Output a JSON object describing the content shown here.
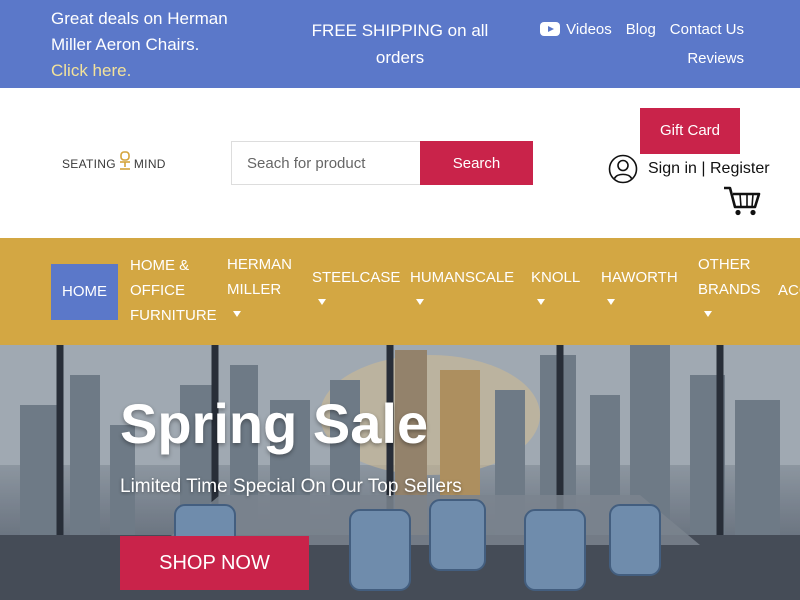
{
  "topbar": {
    "promo_text": "Great deals on Herman Miller Aeron Chairs.",
    "promo_link": "Click here.",
    "shipping": "FREE SHIPPING on all orders",
    "links": {
      "videos": "Videos",
      "blog": "Blog",
      "contact": "Contact Us",
      "reviews": "Reviews"
    }
  },
  "header": {
    "logo_left": "SEATING",
    "logo_right": "MIND",
    "search_placeholder": "Seach for product",
    "search_button": "Search",
    "gift_card": "Gift Card",
    "sign_in": "Sign in",
    "separator": "|",
    "register": "Register"
  },
  "nav": {
    "home": "HOME",
    "home_office_1": "HOME &",
    "home_office_2": "OFFICE",
    "home_office_3": "FURNITURE",
    "herman_1": "HERMAN",
    "herman_2": "MILLER",
    "steelcase": "STEELCASE",
    "humanscale": "HUMANSCALE",
    "knoll": "KNOLL",
    "haworth": "HAWORTH",
    "other_1": "OTHER",
    "other_2": "BRANDS",
    "accessories": "ACC"
  },
  "hero": {
    "title": "Spring Sale",
    "subtitle": "Limited Time Special On Our Top Sellers",
    "button": "SHOP NOW"
  },
  "colors": {
    "topbar": "#5b78c9",
    "accent_red": "#c9234a",
    "nav_gold": "#d3a743",
    "link_yellow": "#f3e29a"
  },
  "icons": [
    "youtube-icon",
    "user-icon",
    "cart-icon",
    "chair-logo-icon",
    "chevron-down-icon"
  ]
}
